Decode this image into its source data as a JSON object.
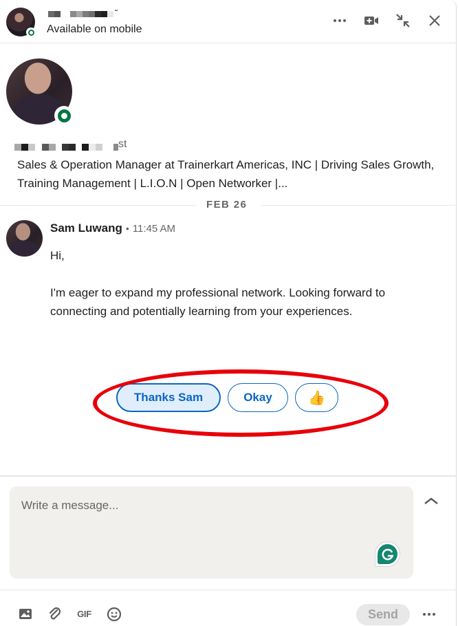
{
  "header": {
    "contact_name_redacted": true,
    "status": "Available on mobile",
    "actions": [
      {
        "name": "more-options",
        "icon": "ellipsis-icon"
      },
      {
        "name": "video-call",
        "icon": "video-camera-plus-icon"
      },
      {
        "name": "minimize",
        "icon": "collapse-arrows-icon"
      },
      {
        "name": "close",
        "icon": "close-icon"
      }
    ]
  },
  "profile": {
    "name_suffix": "st",
    "headline": "Sales & Operation Manager at Trainerkart Americas, INC | Driving Sales Growth, Training Management | L.I.O.N | Open Networker |...",
    "online_status": "online"
  },
  "thread": {
    "date_divider": "FEB 26",
    "messages": [
      {
        "sender": "Sam Luwang",
        "separator": "•",
        "time": "11:45 AM",
        "paragraphs": [
          "Hi,",
          "",
          "I'm eager to expand my professional network. Looking forward to connecting and potentially learning from your experiences."
        ]
      }
    ],
    "suggested_replies": [
      {
        "label": "Thanks Sam"
      },
      {
        "label": "Okay"
      },
      {
        "label": "👍"
      }
    ]
  },
  "composer": {
    "placeholder": "Write a message...",
    "value": "",
    "tools": [
      {
        "name": "attach-image",
        "icon": "image-icon"
      },
      {
        "name": "attach-file",
        "icon": "paperclip-icon"
      },
      {
        "name": "gif",
        "label": "GIF"
      },
      {
        "name": "emoji",
        "icon": "smiley-icon"
      }
    ],
    "send_label": "Send"
  },
  "colors": {
    "accent": "#0a66c2",
    "online": "#057642",
    "annotation": "#e8000a",
    "grammarly": "#15876f"
  }
}
